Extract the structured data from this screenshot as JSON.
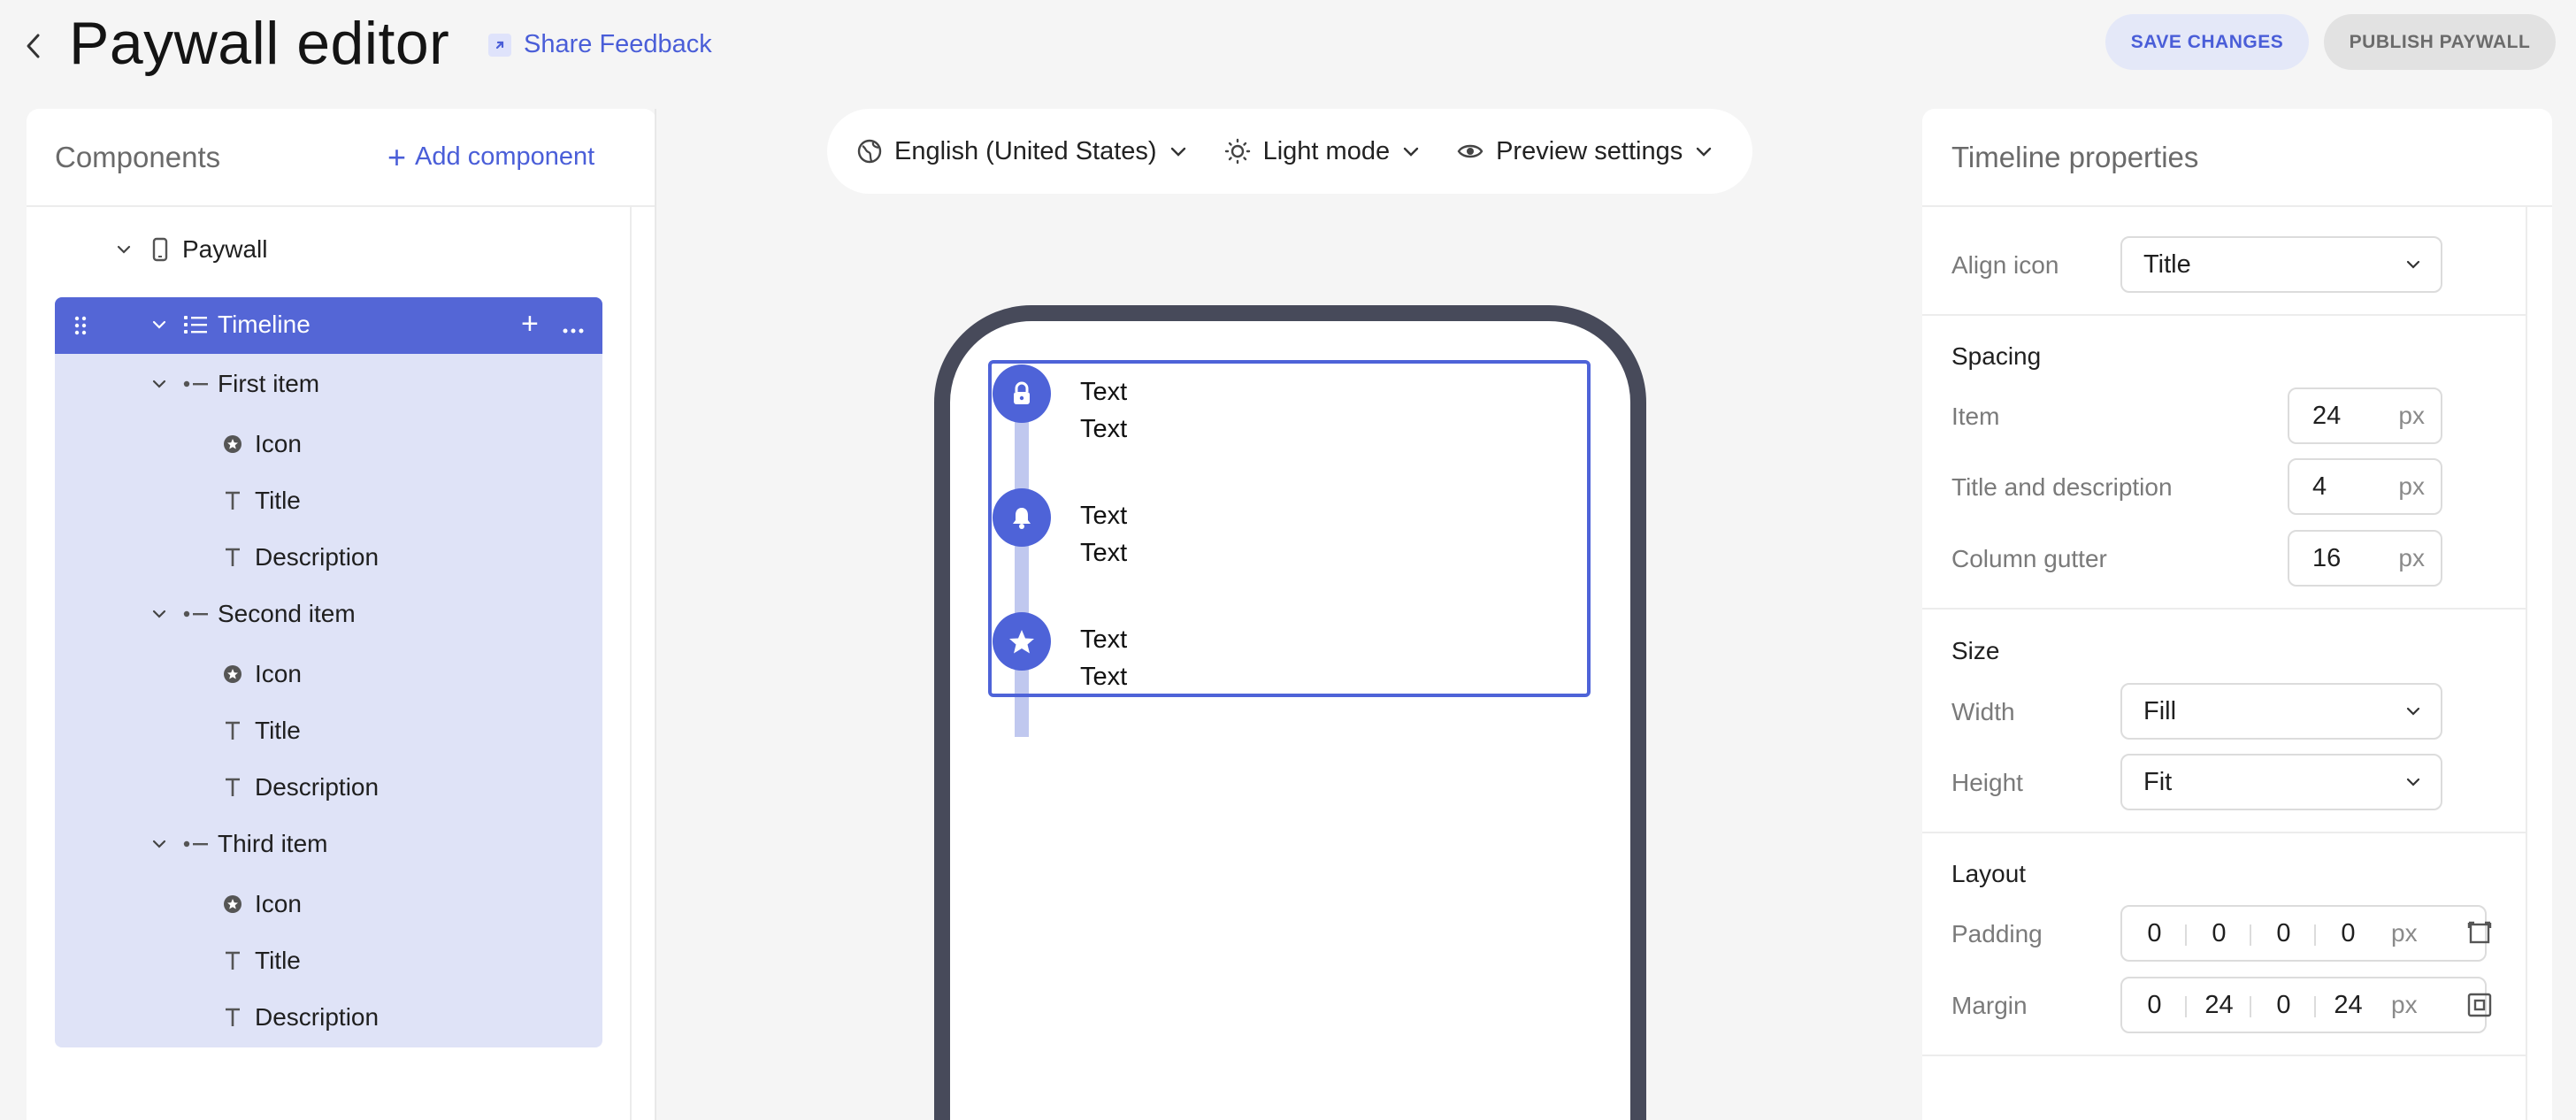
{
  "header": {
    "title": "Paywall editor",
    "feedback_label": "Share Feedback",
    "save_label": "SAVE CHANGES",
    "publish_label": "PUBLISH PAYWALL"
  },
  "components": {
    "title": "Components",
    "add_label": "Add component",
    "tree": {
      "root": "Paywall",
      "timeline": "Timeline",
      "items": [
        {
          "label": "First item",
          "icon": "Icon",
          "title": "Title",
          "description": "Description"
        },
        {
          "label": "Second item",
          "icon": "Icon",
          "title": "Title",
          "description": "Description"
        },
        {
          "label": "Third item",
          "icon": "Icon",
          "title": "Title",
          "description": "Description"
        }
      ]
    }
  },
  "toolbar": {
    "language": "English (United States)",
    "mode": "Light mode",
    "preview": "Preview settings"
  },
  "preview": {
    "items": [
      {
        "icon": "lock-icon",
        "title": "Text",
        "description": "Text"
      },
      {
        "icon": "bell-icon",
        "title": "Text",
        "description": "Text"
      },
      {
        "icon": "star-icon",
        "title": "Text",
        "description": "Text"
      }
    ]
  },
  "properties": {
    "title": "Timeline properties",
    "align_icon_label": "Align icon",
    "align_icon_value": "Title",
    "spacing_title": "Spacing",
    "item_label": "Item",
    "item_value": "24",
    "title_desc_label": "Title and description",
    "title_desc_value": "4",
    "gutter_label": "Column gutter",
    "gutter_value": "16",
    "unit": "px",
    "size_title": "Size",
    "width_label": "Width",
    "width_value": "Fill",
    "height_label": "Height",
    "height_value": "Fit",
    "layout_title": "Layout",
    "padding_label": "Padding",
    "padding": [
      "0",
      "0",
      "0",
      "0"
    ],
    "margin_label": "Margin",
    "margin": [
      "0",
      "24",
      "0",
      "24"
    ]
  },
  "colors": {
    "accent": "#4e63d8",
    "selection_bg": "#dfe3f7",
    "phone_frame": "#474a5a"
  }
}
